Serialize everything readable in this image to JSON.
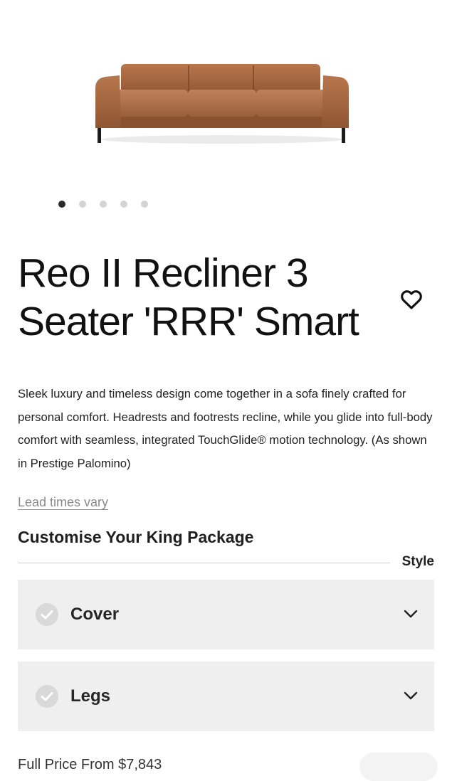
{
  "gallery": {
    "slide_count": 5,
    "active_index": 0,
    "image_icon": "sofa-product-photo",
    "sofa_color": "#a66a45"
  },
  "product": {
    "title": "Reo II Recliner 3 Seater 'RRR' Smart",
    "description": "Sleek luxury and timeless design come together in a sofa finely crafted for personal comfort. Headrests and footrests recline, while you glide into full-body comfort with seamless, integrated TouchGlide® motion technology. (As shown in Prestige Palomino)",
    "lead_times_link": "Lead times vary",
    "favorite_icon": "heart-icon"
  },
  "customise": {
    "heading": "Customise Your King Package",
    "style_label": "Style",
    "options": [
      {
        "label": "Cover",
        "icon": "check-circle-icon",
        "expand_icon": "chevron-down-icon"
      },
      {
        "label": "Legs",
        "icon": "check-circle-icon",
        "expand_icon": "chevron-down-icon"
      }
    ]
  },
  "pricing": {
    "full_price": "Full Price From $7,843"
  }
}
